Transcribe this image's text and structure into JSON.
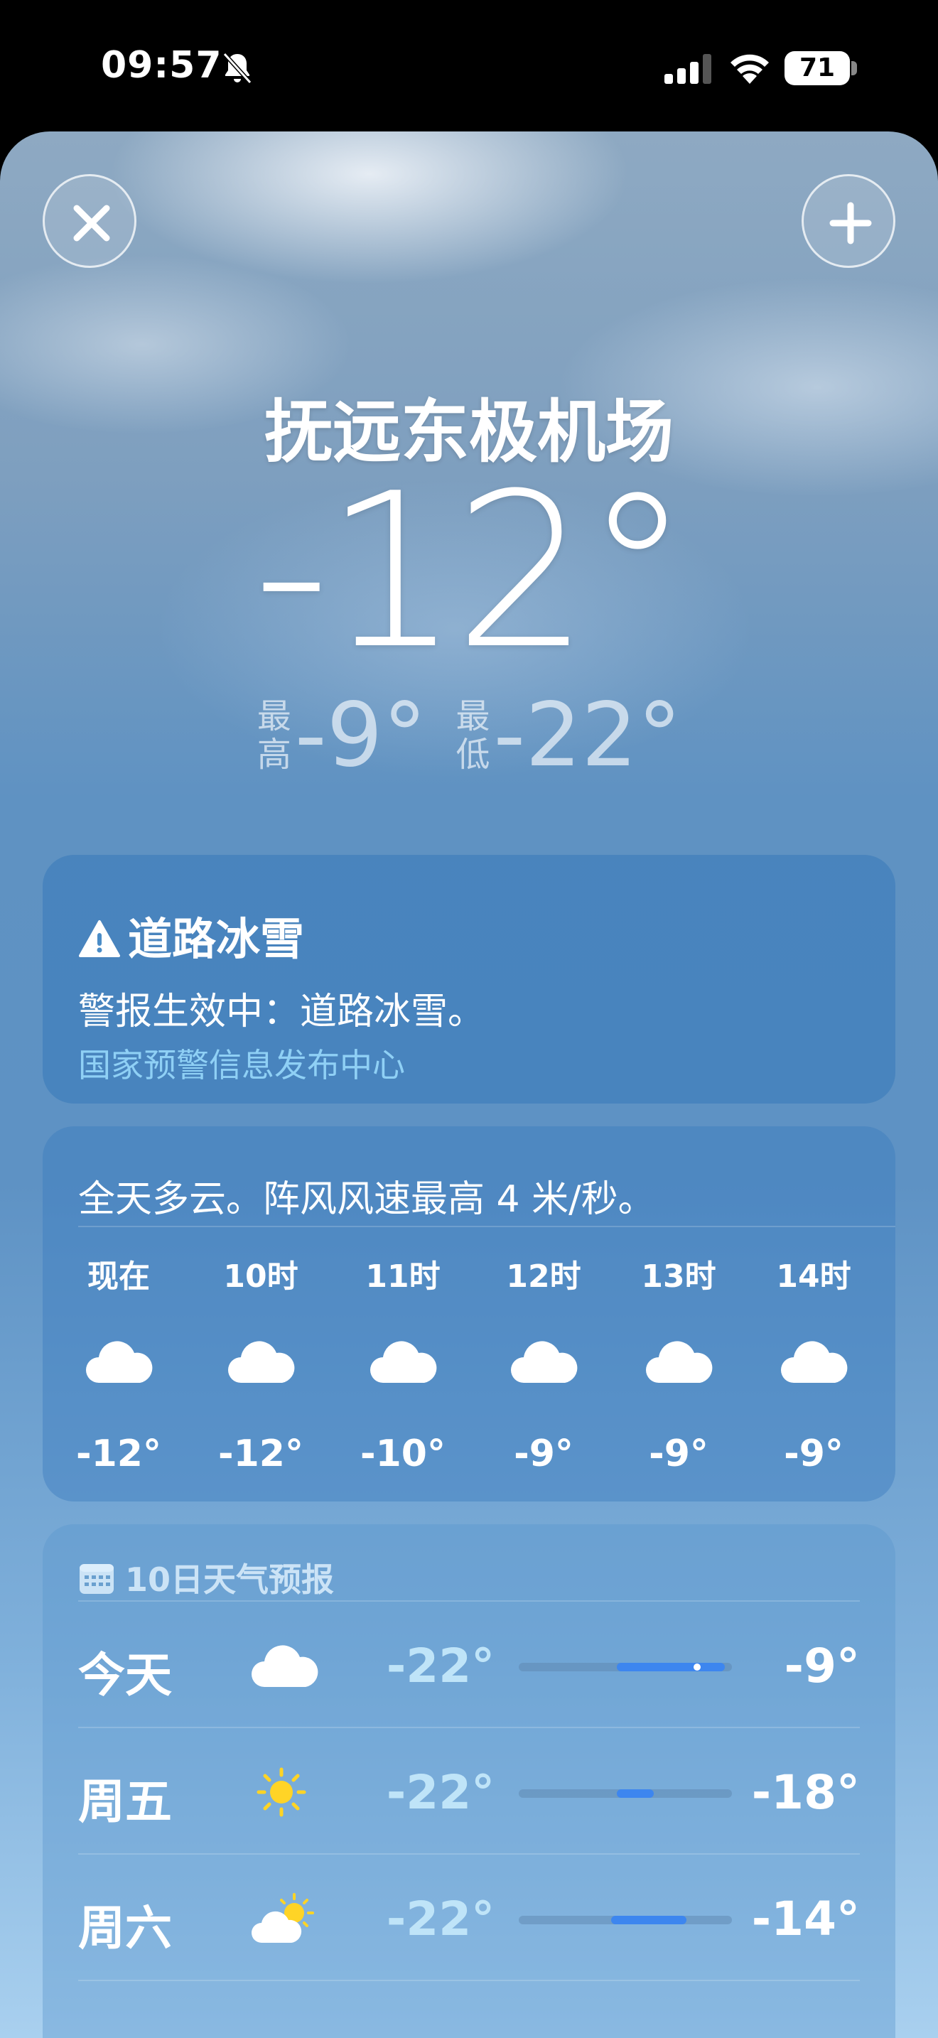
{
  "status_bar": {
    "time": "09:57",
    "battery": "71"
  },
  "header": {
    "location": "抚远东极机场",
    "temperature": "-12°",
    "high_label": "最高",
    "high": "-9°",
    "low_label": "最低",
    "low": "-22°"
  },
  "alert": {
    "title": "道路冰雪",
    "body": "警报生效中：道路冰雪。",
    "source": "国家预警信息发布中心"
  },
  "hourly": {
    "summary": "全天多云。阵风风速最高 4 米/秒。",
    "items": [
      {
        "label": "现在",
        "icon": "cloud-icon",
        "temp": "-12°"
      },
      {
        "label": "10时",
        "icon": "cloud-icon",
        "temp": "-12°"
      },
      {
        "label": "11时",
        "icon": "cloud-icon",
        "temp": "-10°"
      },
      {
        "label": "12时",
        "icon": "cloud-icon",
        "temp": "-9°"
      },
      {
        "label": "13时",
        "icon": "cloud-icon",
        "temp": "-9°"
      },
      {
        "label": "14时",
        "icon": "cloud-icon",
        "temp": "-9°"
      }
    ]
  },
  "daily": {
    "header": "10日天气预报",
    "days": [
      {
        "name": "今天",
        "icon": "cloud-icon",
        "low": "-22°",
        "high": "-9°"
      },
      {
        "name": "周五",
        "icon": "sun-icon",
        "low": "-22°",
        "high": "-18°"
      },
      {
        "name": "周六",
        "icon": "partly-cloudy-icon",
        "low": "-22°",
        "high": "-14°"
      }
    ]
  },
  "colors": {
    "bar_fill": "#3d86ef",
    "alert_source": "#8fd0f5"
  }
}
